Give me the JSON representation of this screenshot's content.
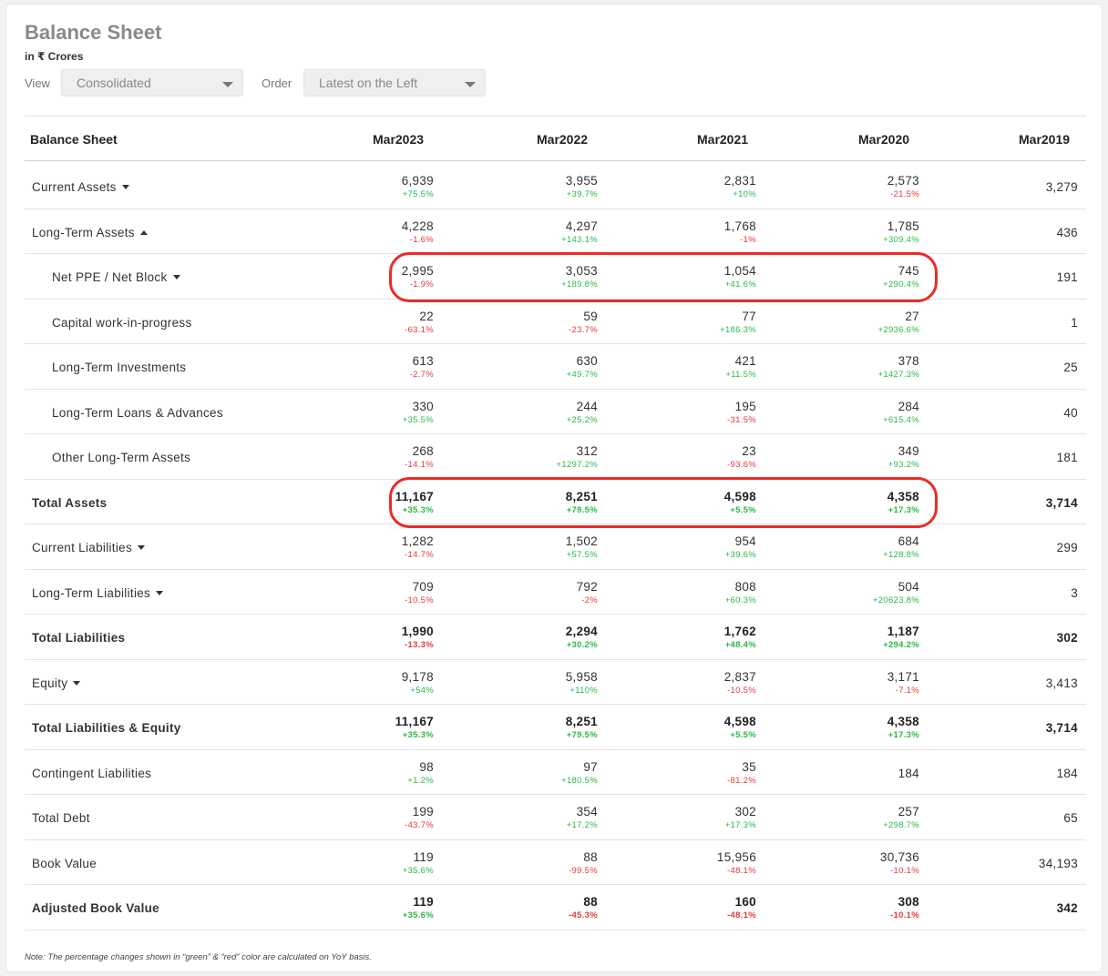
{
  "header": {
    "title": "Balance Sheet",
    "units": "in ₹ Crores"
  },
  "filters": {
    "view_label": "View",
    "view_value": "Consolidated",
    "order_label": "Order",
    "order_value": "Latest on the Left"
  },
  "table": {
    "columns": [
      "Balance Sheet",
      "Mar2023",
      "Mar2022",
      "Mar2021",
      "Mar2020",
      "Mar2019"
    ],
    "rows": [
      {
        "label": "Current Assets",
        "cells": [
          {
            "v": "6,939",
            "p": "+75.5%"
          },
          {
            "v": "3,955",
            "p": "+39.7%"
          },
          {
            "v": "2,831",
            "p": "+10%"
          },
          {
            "v": "2,573",
            "p": "-21.5%"
          },
          {
            "v": "3,279",
            "p": ""
          }
        ]
      },
      {
        "label": "Long-Term Assets",
        "cells": [
          {
            "v": "4,228",
            "p": "-1.6%"
          },
          {
            "v": "4,297",
            "p": "+143.1%"
          },
          {
            "v": "1,768",
            "p": "-1%"
          },
          {
            "v": "1,785",
            "p": "+309.4%"
          },
          {
            "v": "436",
            "p": ""
          }
        ]
      },
      {
        "label": "Net PPE / Net Block",
        "cells": [
          {
            "v": "2,995",
            "p": "-1.9%"
          },
          {
            "v": "3,053",
            "p": "+189.8%"
          },
          {
            "v": "1,054",
            "p": "+41.6%"
          },
          {
            "v": "745",
            "p": "+290.4%"
          },
          {
            "v": "191",
            "p": ""
          }
        ]
      },
      {
        "label": "Capital work-in-progress",
        "cells": [
          {
            "v": "22",
            "p": "-63.1%"
          },
          {
            "v": "59",
            "p": "-23.7%"
          },
          {
            "v": "77",
            "p": "+186.3%"
          },
          {
            "v": "27",
            "p": "+2936.6%"
          },
          {
            "v": "1",
            "p": ""
          }
        ]
      },
      {
        "label": "Long-Term Investments",
        "cells": [
          {
            "v": "613",
            "p": "-2.7%"
          },
          {
            "v": "630",
            "p": "+49.7%"
          },
          {
            "v": "421",
            "p": "+11.5%"
          },
          {
            "v": "378",
            "p": "+1427.3%"
          },
          {
            "v": "25",
            "p": ""
          }
        ]
      },
      {
        "label": "Long-Term Loans & Advances",
        "cells": [
          {
            "v": "330",
            "p": "+35.5%"
          },
          {
            "v": "244",
            "p": "+25.2%"
          },
          {
            "v": "195",
            "p": "-31.5%"
          },
          {
            "v": "284",
            "p": "+615.4%"
          },
          {
            "v": "40",
            "p": ""
          }
        ]
      },
      {
        "label": "Other Long-Term Assets",
        "cells": [
          {
            "v": "268",
            "p": "-14.1%"
          },
          {
            "v": "312",
            "p": "+1297.2%"
          },
          {
            "v": "23",
            "p": "-93.6%"
          },
          {
            "v": "349",
            "p": "+93.2%"
          },
          {
            "v": "181",
            "p": ""
          }
        ]
      },
      {
        "label": "Total Assets",
        "cells": [
          {
            "v": "11,167",
            "p": "+35.3%"
          },
          {
            "v": "8,251",
            "p": "+79.5%"
          },
          {
            "v": "4,598",
            "p": "+5.5%"
          },
          {
            "v": "4,358",
            "p": "+17.3%"
          },
          {
            "v": "3,714",
            "p": ""
          }
        ]
      },
      {
        "label": "Current Liabilities",
        "cells": [
          {
            "v": "1,282",
            "p": "-14.7%"
          },
          {
            "v": "1,502",
            "p": "+57.5%"
          },
          {
            "v": "954",
            "p": "+39.6%"
          },
          {
            "v": "684",
            "p": "+128.8%"
          },
          {
            "v": "299",
            "p": ""
          }
        ]
      },
      {
        "label": "Long-Term Liabilities",
        "cells": [
          {
            "v": "709",
            "p": "-10.5%"
          },
          {
            "v": "792",
            "p": "-2%"
          },
          {
            "v": "808",
            "p": "+60.3%"
          },
          {
            "v": "504",
            "p": "+20623.8%"
          },
          {
            "v": "3",
            "p": ""
          }
        ]
      },
      {
        "label": "Total Liabilities",
        "cells": [
          {
            "v": "1,990",
            "p": "-13.3%"
          },
          {
            "v": "2,294",
            "p": "+30.2%"
          },
          {
            "v": "1,762",
            "p": "+48.4%"
          },
          {
            "v": "1,187",
            "p": "+294.2%"
          },
          {
            "v": "302",
            "p": ""
          }
        ]
      },
      {
        "label": "Equity",
        "cells": [
          {
            "v": "9,178",
            "p": "+54%"
          },
          {
            "v": "5,958",
            "p": "+110%"
          },
          {
            "v": "2,837",
            "p": "-10.5%"
          },
          {
            "v": "3,171",
            "p": "-7.1%"
          },
          {
            "v": "3,413",
            "p": ""
          }
        ]
      },
      {
        "label": "Total Liabilities & Equity",
        "cells": [
          {
            "v": "11,167",
            "p": "+35.3%"
          },
          {
            "v": "8,251",
            "p": "+79.5%"
          },
          {
            "v": "4,598",
            "p": "+5.5%"
          },
          {
            "v": "4,358",
            "p": "+17.3%"
          },
          {
            "v": "3,714",
            "p": ""
          }
        ]
      },
      {
        "label": "Contingent Liabilities",
        "cells": [
          {
            "v": "98",
            "p": "+1.2%"
          },
          {
            "v": "97",
            "p": "+180.5%"
          },
          {
            "v": "35",
            "p": "-81.2%"
          },
          {
            "v": "184",
            "p": ""
          },
          {
            "v": "184",
            "p": ""
          }
        ]
      },
      {
        "label": "Total Debt",
        "cells": [
          {
            "v": "199",
            "p": "-43.7%"
          },
          {
            "v": "354",
            "p": "+17.2%"
          },
          {
            "v": "302",
            "p": "+17.3%"
          },
          {
            "v": "257",
            "p": "+298.7%"
          },
          {
            "v": "65",
            "p": ""
          }
        ]
      },
      {
        "label": "Book Value",
        "cells": [
          {
            "v": "119",
            "p": "+35.6%"
          },
          {
            "v": "88",
            "p": "-99.5%"
          },
          {
            "v": "15,956",
            "p": "-48.1%"
          },
          {
            "v": "30,736",
            "p": "-10.1%"
          },
          {
            "v": "34,193",
            "p": ""
          }
        ]
      },
      {
        "label": "Adjusted Book Value",
        "cells": [
          {
            "v": "119",
            "p": "+35.6%"
          },
          {
            "v": "88",
            "p": "-45.3%"
          },
          {
            "v": "160",
            "p": "-48.1%"
          },
          {
            "v": "308",
            "p": "-10.1%"
          },
          {
            "v": "342",
            "p": ""
          }
        ]
      }
    ]
  },
  "note": "Note: The percentage changes shown in “green” & “red” color are calculated on YoY basis.",
  "colors": {
    "positive": "#2bb84a",
    "negative": "#e23a3a",
    "highlight": "#ee2a25"
  }
}
